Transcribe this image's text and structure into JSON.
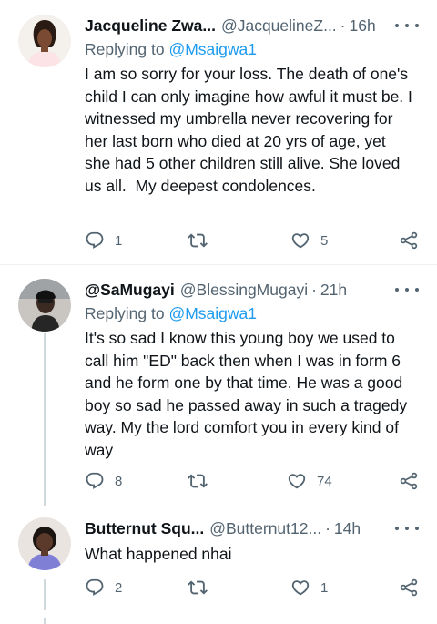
{
  "tweets": [
    {
      "name": "Jacqueline Zwa...",
      "handle": "@JacquelineZ...",
      "separator": "·",
      "time": "16h",
      "replying_label": "Replying to",
      "replying_to": "@Msaigwa1",
      "text": "I am so sorry for your loss. The death of one's child I can only imagine how awful it must be. I witnessed my umbrella never recovering for her last born who died at 20 yrs of age, yet she had 5 other children still alive. She loved us all.  My deepest condolences.",
      "replies": "1",
      "retweets": "",
      "likes": "5"
    },
    {
      "name": "@SaMugayi",
      "handle": "@BlessingMugayi",
      "separator": "·",
      "time": "21h",
      "replying_label": "Replying to",
      "replying_to": "@Msaigwa1",
      "text": "It's so sad I know this young boy we used to call him \"ED\" back then when I was in form 6 and he form one by that time. He was a good boy so sad he passed away in such a tragedy way. My the lord comfort you in every kind of way",
      "replies": "8",
      "retweets": "",
      "likes": "74"
    },
    {
      "name": "Butternut Squ...",
      "handle": "@Butternut12...",
      "separator": "·",
      "time": "14h",
      "text": "What happened nhai",
      "replies": "2",
      "retweets": "",
      "likes": "1"
    }
  ],
  "colors": {
    "text": "#0f1419",
    "secondary": "#536471",
    "link": "#1d9bf0",
    "thread_line": "#cfd9de"
  },
  "icons": [
    "reply-icon",
    "retweet-icon",
    "like-icon",
    "share-icon",
    "more-icon"
  ]
}
